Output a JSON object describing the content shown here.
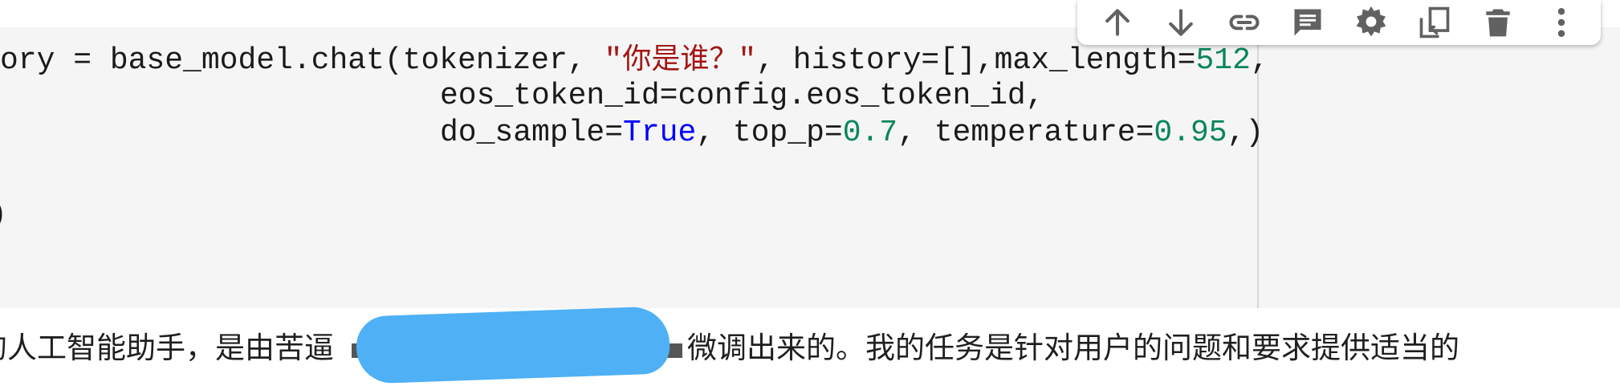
{
  "code": {
    "line1": {
      "pre": "ory = base_model.chat(tokenizer, ",
      "str_open": "\"",
      "str_text": "你是谁？",
      "str_close": "\"",
      "mid": ", history=[],max_length=",
      "num": "512",
      "post": ","
    },
    "line2": {
      "indent": "                      ",
      "text": "eos_token_id=config.eos_token_id,"
    },
    "line3": {
      "indent": "                      ",
      "a": "do_sample=",
      "kw": "True",
      "b": ", top_p=",
      "n1": "0.7",
      "c": ", temperature=",
      "n2": "0.95",
      "d": ",)"
    },
    "line4": ")"
  },
  "toolbar": {
    "buttons": [
      {
        "icon": "arrow-up-icon"
      },
      {
        "icon": "arrow-down-icon"
      },
      {
        "icon": "link-icon"
      },
      {
        "icon": "comment-icon"
      },
      {
        "icon": "settings-gear-icon"
      },
      {
        "icon": "mirror-cell-icon"
      },
      {
        "icon": "delete-trash-icon"
      },
      {
        "icon": "more-vertical-icon"
      }
    ],
    "icon_color": "#616161"
  },
  "output": {
    "before": "的人工智能助手，是由苦逼",
    "after": "微调出来的。我的任务是针对用户的问题和要求提供适当的"
  },
  "colors": {
    "string": "#a31515",
    "number": "#098658",
    "keyword": "#0000ff",
    "redaction": "#4fb0f5"
  }
}
